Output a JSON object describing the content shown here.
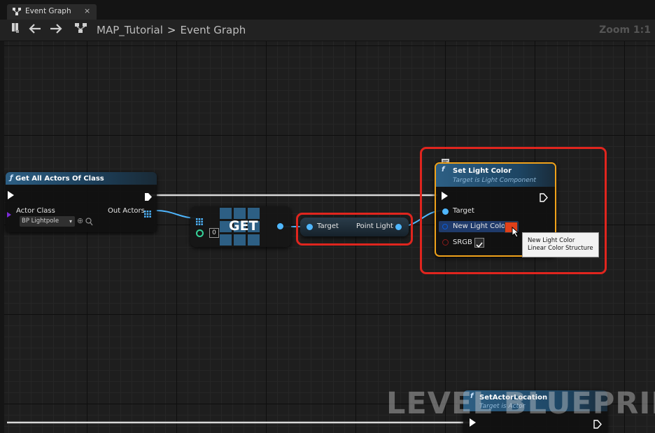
{
  "tab": {
    "title": "Event Graph",
    "close": "×"
  },
  "breadcrumb": {
    "project": "MAP_Tutorial",
    "separator": ">",
    "graph": "Event Graph"
  },
  "zoom": "Zoom 1:1",
  "get_all_actors": {
    "title": "Get All Actors Of Class",
    "actor_class_label": "Actor Class",
    "actor_class_value": "BP Lightpole",
    "out_actors_label": "Out Actors"
  },
  "get_node": {
    "title": "GET",
    "index": "0"
  },
  "point_light_node": {
    "target_label": "Target",
    "output_label": "Point Light"
  },
  "set_light_color": {
    "func_icon": "f",
    "title": "Set Light Color",
    "subtitle": "Target is Light Component",
    "target_label": "Target",
    "new_light_color_label": "New Light Color",
    "srgb_label": "SRGB",
    "srgb_checked": true,
    "color_swatch": "#e0401a"
  },
  "tooltip": {
    "line1": "New Light Color",
    "line2": "Linear Color Structure"
  },
  "set_actor_location": {
    "func_icon": "f",
    "title": "SetActorLocation",
    "subtitle": "Target is Actor"
  },
  "watermark": "LEVEL BLUEPRINT",
  "colors": {
    "highlight": "#e0251e",
    "object_pin": "#4fb7ff",
    "struct_pin": "#0d5bd6",
    "bool_pin": "#8a1b1b"
  }
}
